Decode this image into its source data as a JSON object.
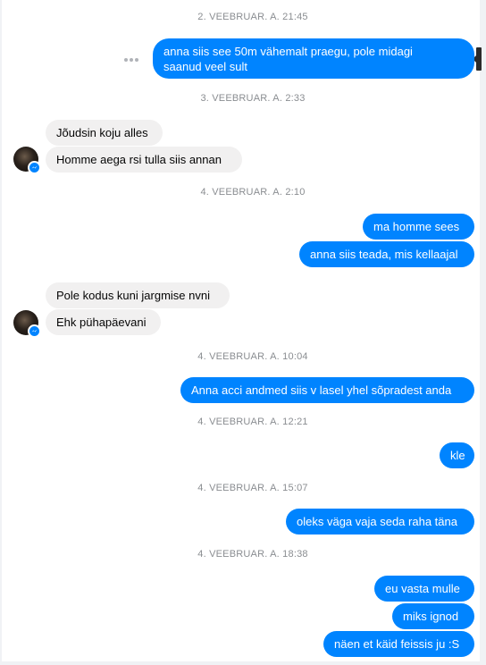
{
  "timestamps": [
    "2. VEEBRUAR. A. 21:45",
    "3. VEEBRUAR. A. 2:33",
    "4. VEEBRUAR. A. 2:10",
    "4. VEEBRUAR. A. 10:04",
    "4. VEEBRUAR. A. 12:21",
    "4. VEEBRUAR. A. 15:07",
    "4. VEEBRUAR. A. 18:38"
  ],
  "messages": {
    "m1_line1": "anna siis see 50m vähemalt praegu, pole midagi",
    "m1_line2": "saanud veel sult",
    "m2": "Jõudsin koju alles",
    "m3": "Homme aega rsi tulla siis annan",
    "m4": "ma homme sees",
    "m5": "anna siis teada, mis kellaajal",
    "m6": "Pole kodus kuni jargmise nvni",
    "m7": "Ehk pühapäevani",
    "m8": "Anna acci andmed siis v lasel yhel sõpradest anda",
    "m9": "kle",
    "m10": "oleks väga vaja seda raha täna",
    "m11": "eu vasta mulle",
    "m12": "miks ignod",
    "m13": "näen et käid feissis ju :S"
  },
  "icons": {
    "more": "more-horizontal-icon",
    "messenger_badge": "messenger-badge-icon"
  },
  "colors": {
    "outgoing": "#0084ff",
    "incoming": "#f1f0f0",
    "timestamp": "#8a8d91"
  }
}
